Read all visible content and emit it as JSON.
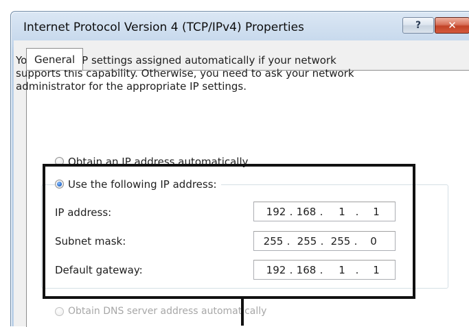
{
  "window": {
    "title": "Internet Protocol Version 4 (TCP/IPv4) Properties",
    "help_glyph": "?",
    "close_glyph": "✕"
  },
  "tabs": [
    {
      "label": "General",
      "selected": true
    }
  ],
  "description": "You can get IP settings assigned automatically if your network supports this capability. Otherwise, you need to ask your network administrator for the appropriate IP settings.",
  "ip_mode": {
    "auto_label": "Obtain an IP address automatically",
    "manual_label": "Use the following IP address:",
    "selected": "manual"
  },
  "fields": [
    {
      "label": "IP address:",
      "octets": [
        "192",
        "168",
        "1",
        "1"
      ]
    },
    {
      "label": "Subnet mask:",
      "octets": [
        "255",
        "255",
        "255",
        "0"
      ]
    },
    {
      "label": "Default gateway:",
      "octets": [
        "192",
        "168",
        "1",
        "1"
      ]
    }
  ],
  "dns_mode": {
    "auto_label": "Obtain DNS server address automatically",
    "enabled": false
  },
  "colors": {
    "highlight_border": "#111111",
    "close_button": "#c24327",
    "radio_selected": "#1d63c8"
  }
}
